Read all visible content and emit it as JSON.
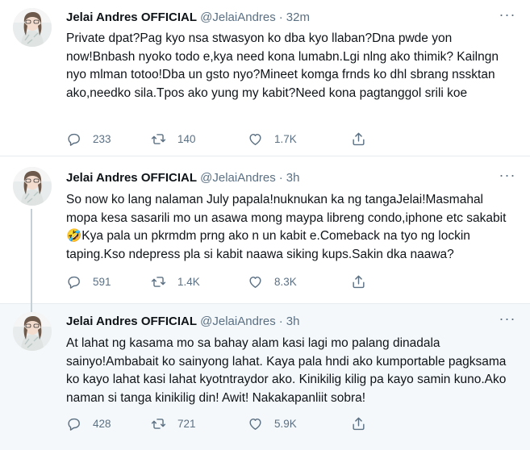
{
  "colors": {
    "text": "#0f1419",
    "secondary": "#5b7083",
    "border": "#e6ecf0",
    "highlight_bg": "#f5f8fa",
    "thread_line": "#c4cfd6"
  },
  "icons": {
    "reply": "speech-bubble",
    "retweet": "retweet-arrows",
    "like": "heart",
    "share": "share-upload",
    "more": "ellipsis"
  },
  "tweets": [
    {
      "name": "Jelai Andres OFFICIAL",
      "handle": "@JelaiAndres",
      "dot": "·",
      "time": "32m",
      "more": "···",
      "text": "Private dpat?Pag kyo nsa stwasyon ko dba kyo llaban?Dna pwde yon now!Bnbash nyoko todo e,kya need kona lumabn.Lgi nlng ako thimik? Kailngn nyo mlman totoo!Dba un gsto nyo?Mineet komga frnds ko dhl sbrang nssktan ako,needko sila.Tpos ako yung my kabit?Need kona pagtanggol srili koe",
      "replies": "233",
      "retweets": "140",
      "likes": "1.7K"
    },
    {
      "name": "Jelai Andres OFFICIAL",
      "handle": "@JelaiAndres",
      "dot": "·",
      "time": "3h",
      "more": "···",
      "text": "So now ko lang nalaman July papala!nuknukan ka ng tangaJelai!Masmahal mopa kesa sasarili mo un asawa mong maypa libreng condo,iphone etc sakabit🤣Kya pala un pkrmdm prng ako n un kabit e.Comeback na tyo ng lockin taping.Kso ndepress pla si kabit naawa siking kups.Sakin dka naawa?",
      "replies": "591",
      "retweets": "1.4K",
      "likes": "8.3K"
    },
    {
      "name": "Jelai Andres OFFICIAL",
      "handle": "@JelaiAndres",
      "dot": "·",
      "time": "3h",
      "more": "···",
      "text": "At lahat ng kasama mo sa bahay alam kasi lagi mo palang dinadala sainyo!Ambabait ko sainyong lahat. Kaya pala hndi ako kumportable pagksama ko kayo lahat kasi lahat kyotntraydor ako. Kinikilig kilig pa kayo samin kuno.Ako naman si tanga kinikilig din! Awit! Nakakapanliit sobra!",
      "replies": "428",
      "retweets": "721",
      "likes": "5.9K"
    }
  ]
}
